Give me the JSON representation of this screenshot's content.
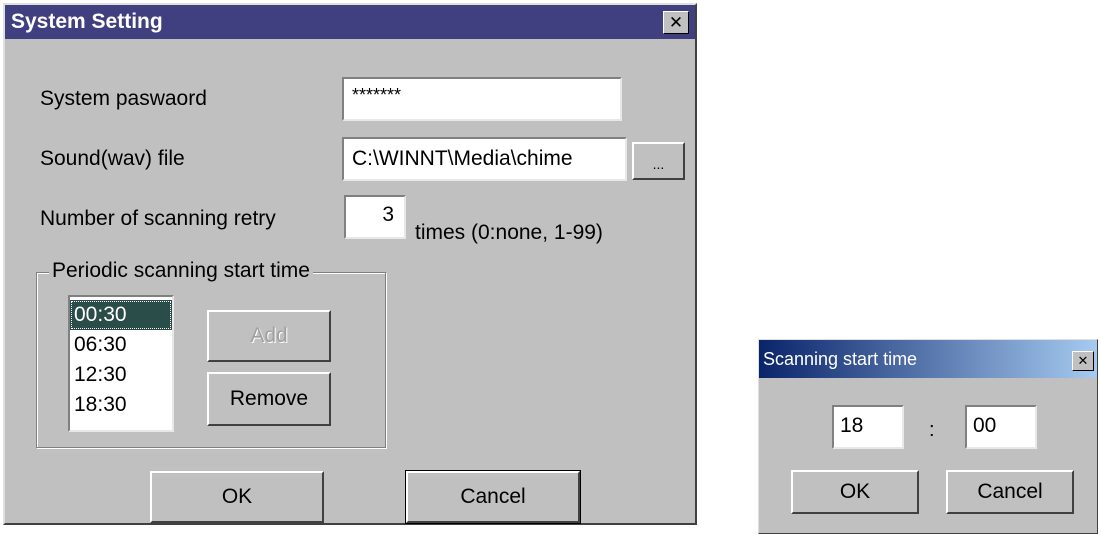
{
  "system_setting": {
    "title": "System Setting",
    "close_glyph": "✕",
    "password_label": "System paswaord",
    "password_value": "*******",
    "sound_label": "Sound(wav) file",
    "sound_value": "C:\\WINNT\\Media\\chime",
    "browse_label": "...",
    "retry_label": "Number of scanning retry",
    "retry_value": "3",
    "retry_suffix": "times (0:none, 1-99)",
    "group_label": "Periodic scanning start time",
    "times": [
      "00:30",
      "06:30",
      "12:30",
      "18:30"
    ],
    "selected_time": "00:30",
    "add_label": "Add",
    "remove_label": "Remove",
    "ok_label": "OK",
    "cancel_label": "Cancel"
  },
  "scan_start": {
    "title": "Scanning start time",
    "close_glyph": "✕",
    "hour_value": "18",
    "separator": ":",
    "minute_value": "00",
    "ok_label": "OK",
    "cancel_label": "Cancel"
  },
  "colors": {
    "title_main": "#404080",
    "title_small_start": "#0a246a",
    "title_small_end": "#a6caf0",
    "face": "#c0c0c0",
    "selection": "#2b4d4a"
  }
}
